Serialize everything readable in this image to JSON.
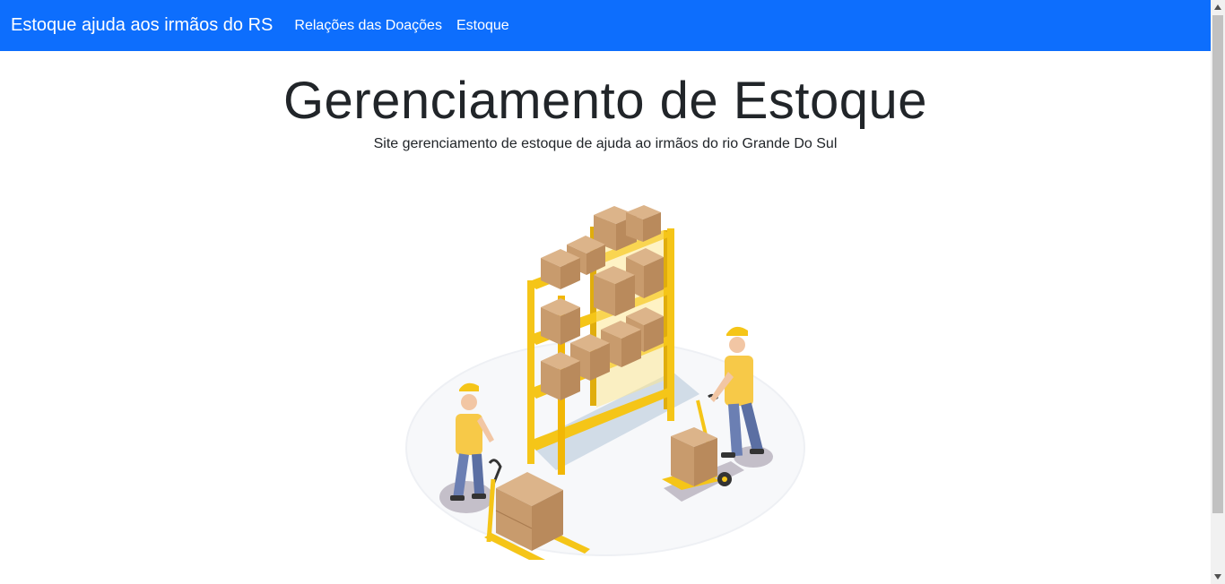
{
  "navbar": {
    "brand": "Estoque ajuda aos irmãos do RS",
    "links": [
      "Relações das Doações",
      "Estoque"
    ]
  },
  "hero": {
    "title": "Gerenciamento de Estoque",
    "subtitle": "Site gerenciamento de estoque de ajuda ao irmãos do rio Grande Do Sul"
  },
  "icons": {
    "illustration": "warehouse-workers-illustration",
    "scroll_up": "chevron-up-icon",
    "scroll_down": "chevron-down-icon"
  },
  "colors": {
    "navbar": "#0d6efd",
    "shelf": "#f5c518",
    "box": "#c89b6d",
    "shirt": "#f7c948",
    "pants": "#6b7fb3"
  }
}
